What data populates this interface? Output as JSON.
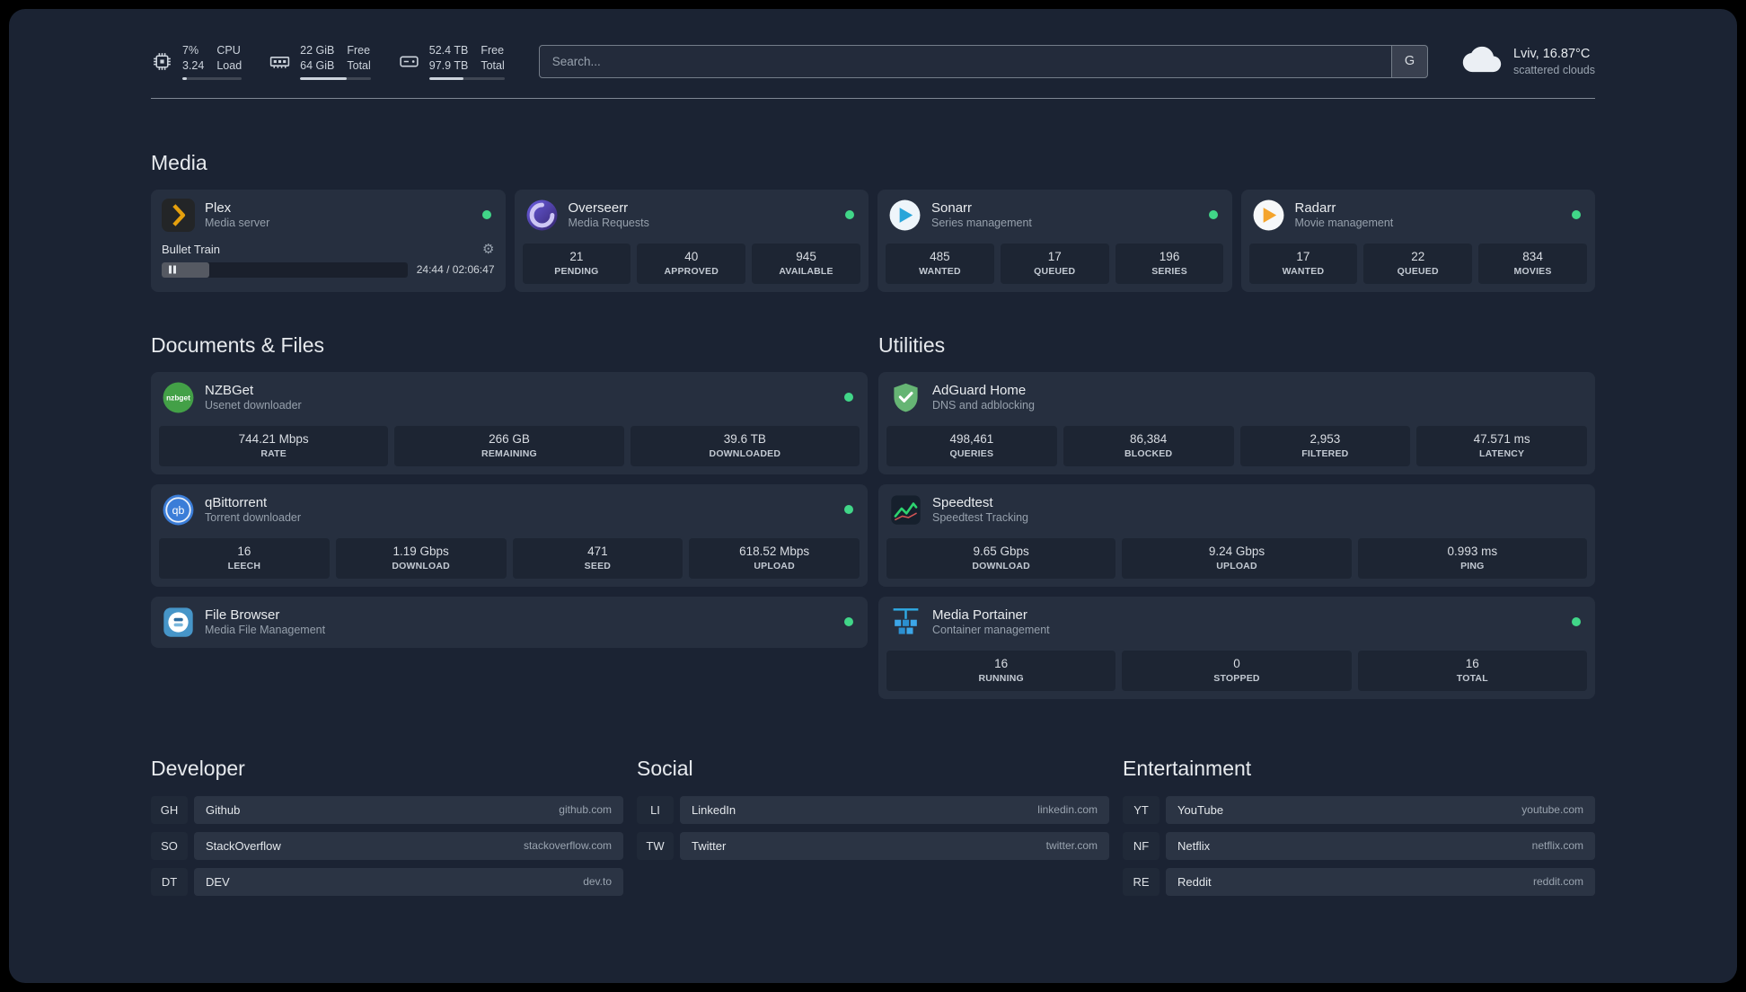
{
  "topbar": {
    "cpu": {
      "usage": "7%",
      "load": "3.24",
      "label_top": "CPU",
      "label_bottom": "Load",
      "percent": 7
    },
    "memory": {
      "free": "22 GiB",
      "total": "64 GiB",
      "label_top": "Free",
      "label_bottom": "Total",
      "percent": 66
    },
    "disk": {
      "free": "52.4 TB",
      "total": "97.9 TB",
      "label_top": "Free",
      "label_bottom": "Total",
      "percent": 46
    },
    "search": {
      "placeholder": "Search...",
      "provider_label": "G"
    },
    "weather": {
      "location": "Lviv, 16.87°C",
      "condition": "scattered clouds"
    }
  },
  "media": {
    "title": "Media",
    "plex": {
      "name": "Plex",
      "subtitle": "Media server",
      "now_playing": "Bullet Train",
      "time": "24:44 / 02:06:47",
      "progress_percent": 19.5
    },
    "overseerr": {
      "name": "Overseerr",
      "subtitle": "Media Requests",
      "stats": [
        {
          "value": "21",
          "label": "PENDING"
        },
        {
          "value": "40",
          "label": "APPROVED"
        },
        {
          "value": "945",
          "label": "AVAILABLE"
        }
      ]
    },
    "sonarr": {
      "name": "Sonarr",
      "subtitle": "Series management",
      "stats": [
        {
          "value": "485",
          "label": "WANTED"
        },
        {
          "value": "17",
          "label": "QUEUED"
        },
        {
          "value": "196",
          "label": "SERIES"
        }
      ]
    },
    "radarr": {
      "name": "Radarr",
      "subtitle": "Movie management",
      "stats": [
        {
          "value": "17",
          "label": "WANTED"
        },
        {
          "value": "22",
          "label": "QUEUED"
        },
        {
          "value": "834",
          "label": "MOVIES"
        }
      ]
    }
  },
  "documents": {
    "title": "Documents & Files",
    "nzbget": {
      "name": "NZBGet",
      "subtitle": "Usenet downloader",
      "stats": [
        {
          "value": "744.21 Mbps",
          "label": "RATE"
        },
        {
          "value": "266 GB",
          "label": "REMAINING"
        },
        {
          "value": "39.6 TB",
          "label": "DOWNLOADED"
        }
      ]
    },
    "qbittorrent": {
      "name": "qBittorrent",
      "subtitle": "Torrent downloader",
      "stats": [
        {
          "value": "16",
          "label": "LEECH"
        },
        {
          "value": "1.19 Gbps",
          "label": "DOWNLOAD"
        },
        {
          "value": "471",
          "label": "SEED"
        },
        {
          "value": "618.52 Mbps",
          "label": "UPLOAD"
        }
      ]
    },
    "filebrowser": {
      "name": "File Browser",
      "subtitle": "Media File Management"
    }
  },
  "utilities": {
    "title": "Utilities",
    "adguard": {
      "name": "AdGuard Home",
      "subtitle": "DNS and adblocking",
      "stats": [
        {
          "value": "498,461",
          "label": "QUERIES"
        },
        {
          "value": "86,384",
          "label": "BLOCKED"
        },
        {
          "value": "2,953",
          "label": "FILTERED"
        },
        {
          "value": "47.571 ms",
          "label": "LATENCY"
        }
      ]
    },
    "speedtest": {
      "name": "Speedtest",
      "subtitle": "Speedtest Tracking",
      "stats": [
        {
          "value": "9.65 Gbps",
          "label": "DOWNLOAD"
        },
        {
          "value": "9.24 Gbps",
          "label": "UPLOAD"
        },
        {
          "value": "0.993 ms",
          "label": "PING"
        }
      ]
    },
    "portainer": {
      "name": "Media Portainer",
      "subtitle": "Container management",
      "stats": [
        {
          "value": "16",
          "label": "RUNNING"
        },
        {
          "value": "0",
          "label": "STOPPED"
        },
        {
          "value": "16",
          "label": "TOTAL"
        }
      ]
    }
  },
  "bookmarks": {
    "developer": {
      "title": "Developer",
      "items": [
        {
          "abbr": "GH",
          "name": "Github",
          "url": "github.com"
        },
        {
          "abbr": "SO",
          "name": "StackOverflow",
          "url": "stackoverflow.com"
        },
        {
          "abbr": "DT",
          "name": "DEV",
          "url": "dev.to"
        }
      ]
    },
    "social": {
      "title": "Social",
      "items": [
        {
          "abbr": "LI",
          "name": "LinkedIn",
          "url": "linkedin.com"
        },
        {
          "abbr": "TW",
          "name": "Twitter",
          "url": "twitter.com"
        }
      ]
    },
    "entertainment": {
      "title": "Entertainment",
      "items": [
        {
          "abbr": "YT",
          "name": "YouTube",
          "url": "youtube.com"
        },
        {
          "abbr": "NF",
          "name": "Netflix",
          "url": "netflix.com"
        },
        {
          "abbr": "RE",
          "name": "Reddit",
          "url": "reddit.com"
        }
      ]
    }
  },
  "colors": {
    "status_online": "#41d688",
    "page_bg": "#1b2333"
  }
}
